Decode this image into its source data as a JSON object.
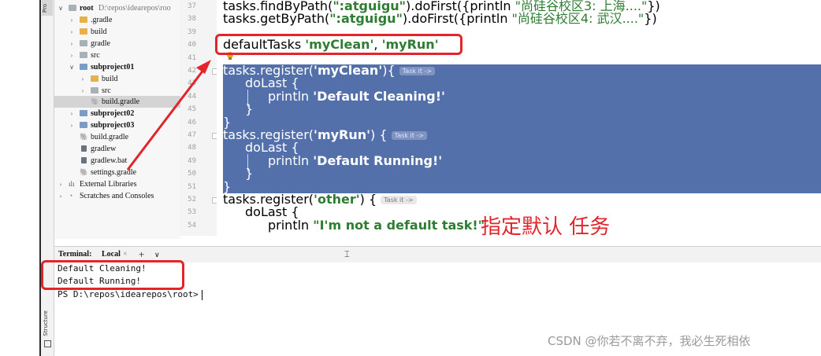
{
  "project_tree": {
    "root_label": "root",
    "root_path": "D:\\repos\\idearepos\\roo",
    "items": [
      {
        "label": ".gradle"
      },
      {
        "label": "build"
      },
      {
        "label": "gradle"
      },
      {
        "label": "src"
      },
      {
        "label": "subproject01"
      },
      {
        "label": "build"
      },
      {
        "label": "src"
      },
      {
        "label": "build.gradle"
      },
      {
        "label": "subproject02"
      },
      {
        "label": "subproject03"
      },
      {
        "label": "build.gradle"
      },
      {
        "label": "gradlew"
      },
      {
        "label": "gradlew.bat"
      },
      {
        "label": "settings.gradle"
      },
      {
        "label": "External Libraries"
      },
      {
        "label": "Scratches and Consoles"
      }
    ]
  },
  "sidebar": {
    "project_tab": "Pro",
    "structure_tab": "Structure"
  },
  "gutter": {
    "line_numbers": [
      "37",
      "38",
      "39",
      "40",
      "41",
      "42",
      "43",
      "44",
      "45",
      "46",
      "47",
      "48",
      "49",
      "50",
      "51",
      "52",
      "53",
      "54"
    ]
  },
  "editor": {
    "l37_a": "tasks.findByPath(",
    "l37_b": "\":atguigu\"",
    "l37_c": ").doFirst({println ",
    "l37_d": "\"尚硅谷校区3: 上海....\"",
    "l37_e": "})",
    "l38_a": "tasks.getByPath(",
    "l38_b": "\":atguigu\"",
    "l38_c": ").doFirst({println ",
    "l38_d": "\"尚硅谷校区4: 武汉....\"",
    "l38_e": "})",
    "l40_a": "defaultTasks ",
    "l40_b": "'myClean'",
    "l40_c": ", ",
    "l40_d": "'myRun'",
    "l42_a": "tasks.register(",
    "l42_b": "'myClean'",
    "l42_c": "){",
    "l43": "doLast {",
    "l44_a": "println ",
    "l44_b": "'Default Cleaning!'",
    "l45": "}",
    "l46": "}",
    "l47_a": "tasks.register(",
    "l47_b": "'myRun'",
    "l47_c": ") {",
    "l48": "doLast {",
    "l49_a": "println ",
    "l49_b": "'Default Running!'",
    "l50": "}",
    "l51": "}",
    "l52_a": "tasks.register(",
    "l52_b": "'other'",
    "l52_c": ") {",
    "l53": "doLast {",
    "l54_a": "println ",
    "l54_b": "\"I'm not a default task!\"",
    "hint": "Task it ->"
  },
  "annotation": {
    "text": "指定默认 任务"
  },
  "terminal": {
    "label": "Terminal:",
    "tab": "Local",
    "tab_close": "×",
    "add": "+",
    "dropdown": "∨",
    "lines": [
      "Default Cleaning!",
      "Default Running!"
    ],
    "prompt": "PS D:\\repos\\idearepos\\root>"
  },
  "watermark": "CSDN @你若不离不弃，我必生死相依",
  "colors": {
    "selection": "#5470ab",
    "annotation_red": "#e3242b",
    "string_green": "#2e7d32"
  }
}
